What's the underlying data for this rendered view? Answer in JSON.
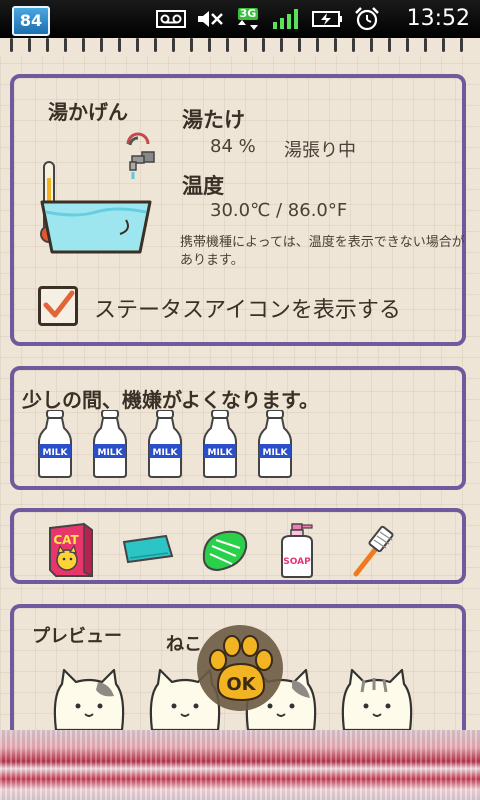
{
  "status_bar": {
    "app_badge": "84",
    "time": "13:52",
    "network": "3G",
    "icons": [
      "voicemail-icon",
      "mute-icon",
      "3g-icon",
      "signal-icon",
      "battery-charging-icon",
      "alarm-icon"
    ]
  },
  "hot_water": {
    "title": "湯かげん",
    "level_heading": "湯たけ",
    "level_value": "84 %",
    "level_state": "湯張り中",
    "temp_heading": "温度",
    "temp_value": "30.0℃ / 86.0°F",
    "note": "携帯機種によっては、温度を表示できない場合があります。",
    "show_status_icon_label": "ステータスアイコンを表示する",
    "show_status_icon_checked": true
  },
  "mood": {
    "text": "少しの間、機嫌がよくなります。",
    "milk_label": "MILK",
    "milk_count": 5
  },
  "items": {
    "cat_box_label": "CAT",
    "soap_label": "SOAP",
    "list": [
      "cat-food-box",
      "towel",
      "sponge",
      "soap-bottle",
      "brush"
    ]
  },
  "preview": {
    "label": "プレビュー",
    "neko_label": "ねこ"
  },
  "ok_button": {
    "label": "OK"
  },
  "colors": {
    "panel_border": "#6f5a9e",
    "background": "#efe5d6",
    "checkbox_mark": "#e0663a",
    "ok_paw": "#f2b422",
    "ok_bg": "#6b5a44"
  }
}
